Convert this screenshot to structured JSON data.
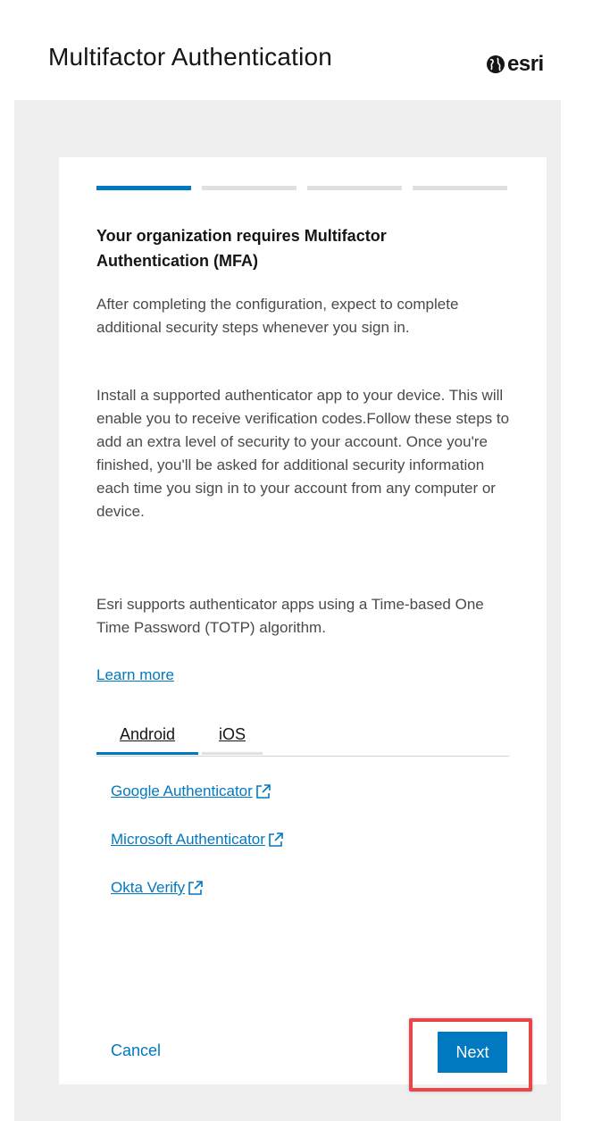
{
  "header": {
    "title": "Multifactor Authentication",
    "logo_text": "esri",
    "logo_icon": "globe-icon"
  },
  "steps": {
    "total": 4,
    "current": 1
  },
  "content": {
    "heading": "Your organization requires Multifactor Authentication (MFA)",
    "paragraph1": "After completing the configuration, expect to complete additional security steps whenever you sign in.",
    "paragraph2": "Install a supported authenticator app to your device. This will enable you to receive verification codes.Follow these steps to add an extra level of security to your account. Once you're finished, you'll be asked for additional security information each time you sign in to your account from any computer or device.",
    "paragraph3": "Esri supports authenticator apps using a Time-based One Time Password (TOTP) algorithm.",
    "learn_more": "Learn more"
  },
  "tabs": [
    {
      "label": "Android",
      "selected": true
    },
    {
      "label": "iOS",
      "selected": false
    }
  ],
  "apps": [
    {
      "label": "Google Authenticator",
      "icon": "external-link-icon"
    },
    {
      "label": "Microsoft Authenticator",
      "icon": "external-link-icon"
    },
    {
      "label": "Okta Verify",
      "icon": "external-link-icon"
    }
  ],
  "actions": {
    "cancel": "Cancel",
    "next": "Next"
  },
  "colors": {
    "accent": "#0079c1",
    "highlight": "#e8474a",
    "background": "#efefef"
  }
}
